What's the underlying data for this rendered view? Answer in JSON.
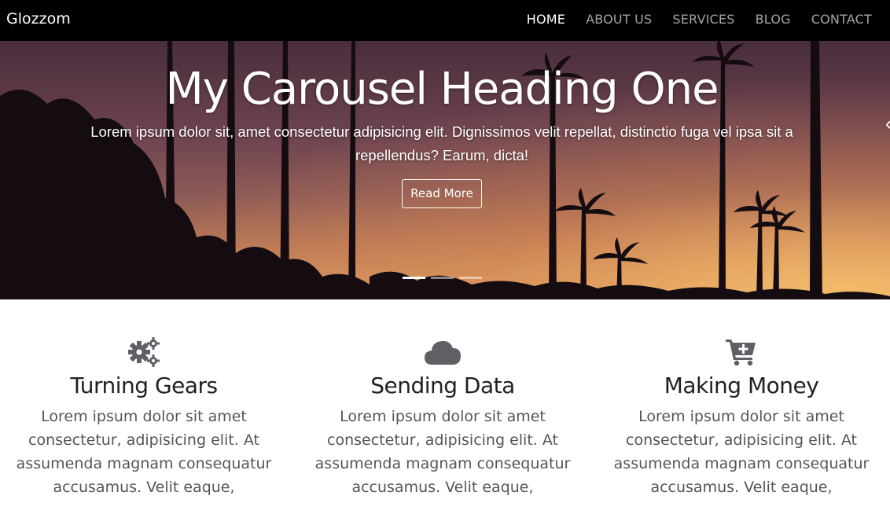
{
  "navbar": {
    "brand": "Glozzom",
    "links": [
      "HOME",
      "ABOUT US",
      "SERVICES",
      "BLOG",
      "CONTACT"
    ]
  },
  "carousel": {
    "heading": "My Carousel Heading One",
    "text": "Lorem ipsum dolor sit, amet consectetur adipisicing elit. Dignissimos velit repellat, distinctio fuga vel ipsa sit a repellendus? Earum, dicta!",
    "button": "Read More",
    "slides": 3,
    "active_slide": 1
  },
  "features": [
    {
      "icon": "gears-icon",
      "title": "Turning Gears",
      "text": "Lorem ipsum dolor sit amet consectetur, adipisicing elit. At assumenda magnam consequatur accusamus. Velit eaque,"
    },
    {
      "icon": "cloud-icon",
      "title": "Sending Data",
      "text": "Lorem ipsum dolor sit amet consectetur, adipisicing elit. At assumenda magnam consequatur accusamus. Velit eaque,"
    },
    {
      "icon": "cart-plus-icon",
      "title": "Making Money",
      "text": "Lorem ipsum dolor sit amet consectetur, adipisicing elit. At assumenda magnam consequatur accusamus. Velit eaque,"
    }
  ],
  "colors": {
    "navbar_bg": "#000000",
    "nav_active": "#ffffff",
    "nav_inactive": "#a3a3a3",
    "icon": "#5f5f66",
    "title": "#212121",
    "body_text": "#555555"
  }
}
